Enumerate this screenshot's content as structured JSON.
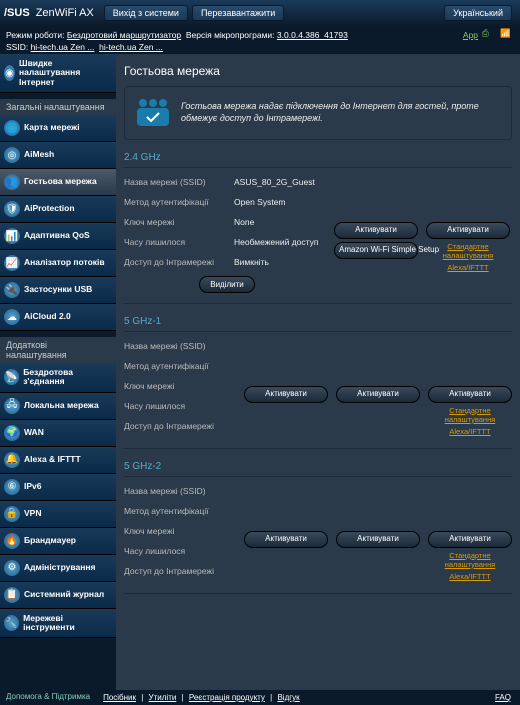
{
  "header": {
    "brand": "/SUS",
    "product": "ZenWiFi AX",
    "logout": "Вихід з системи",
    "reboot": "Перезавантажити",
    "language": "Український"
  },
  "subbar": {
    "mode_label": "Режим роботи:",
    "mode_value": "Бездротовий маршрутизатор",
    "fw_label": "Версія мікропрограми:",
    "fw_value": "3.0.0.4.386_41793",
    "ssid_label": "SSID:",
    "ssid1": "hi-tech.ua Zen ...",
    "ssid2": "hi-tech.ua Zen ...",
    "app": "App"
  },
  "sidebar": {
    "quick": "Швидке налаштування Інтернет",
    "section1": "Загальні налаштування",
    "items1": [
      {
        "label": "Карта мережі"
      },
      {
        "label": "AiMesh"
      },
      {
        "label": "Гостьова мережа"
      },
      {
        "label": "AiProtection"
      },
      {
        "label": "Адаптивна QoS"
      },
      {
        "label": "Аналізатор потоків"
      },
      {
        "label": "Застосунки USB"
      },
      {
        "label": "AiCloud 2.0"
      }
    ],
    "section2": "Додаткові налаштування",
    "items2": [
      {
        "label": "Бездротова з'єднання"
      },
      {
        "label": "Локальна мережа"
      },
      {
        "label": "WAN"
      },
      {
        "label": "Alexa & IFTTT"
      },
      {
        "label": "IPv6"
      },
      {
        "label": "VPN"
      },
      {
        "label": "Брандмауер"
      },
      {
        "label": "Адміністрування"
      },
      {
        "label": "Системний журнал"
      },
      {
        "label": "Мережеві інструменти"
      }
    ]
  },
  "page": {
    "title": "Гостьова мережа",
    "intro": "Гостьова мережа надає підключення до Інтернет для гостей, проте обмежує доступ до Інтрамережі.",
    "labels": {
      "ssid": "Назва мережі (SSID)",
      "auth": "Метод аутентифікації",
      "key": "Ключ мережі",
      "time": "Часу лишилося",
      "intranet": "Доступ до Інтрамережі"
    },
    "values": {
      "ssid": "ASUS_80_2G_Guest",
      "auth": "Open System",
      "key": "None",
      "time": "Необмежений доступ",
      "intranet": "Вимкніть"
    },
    "bands": [
      "2.4 GHz",
      "5 GHz-1",
      "5 GHz-2"
    ],
    "buttons": {
      "enable": "Активувати",
      "show": "Виділити",
      "aws": "Amazon Wi-Fi Simple Setup",
      "default_note": "Стандартне налаштування",
      "alexa": "Alexa/IFTTT"
    }
  },
  "footer": {
    "help": "Допомога & Підтримка",
    "links": [
      "Посібник",
      "Утиліти",
      "Реєстрація продукту",
      "Відгук"
    ],
    "faq": "FAQ"
  }
}
